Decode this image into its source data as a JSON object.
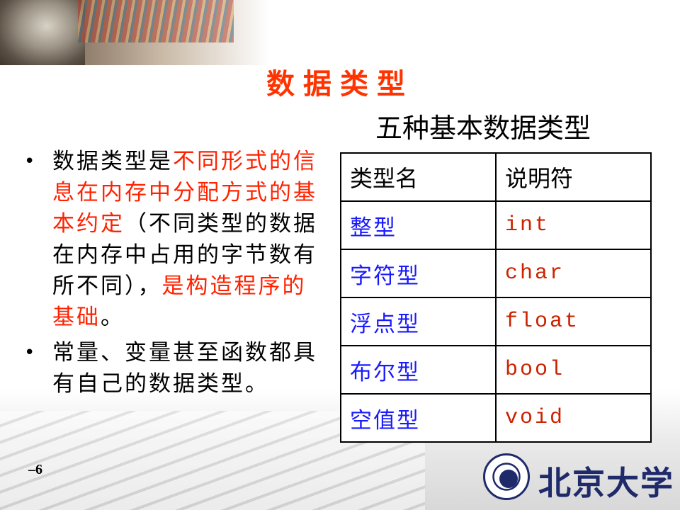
{
  "title": "数据类型",
  "subtitle": "五种基本数据类型",
  "bullets": [
    {
      "segments": [
        {
          "text": "数据类型是",
          "color": "black"
        },
        {
          "text": "不同形式的信息在内存中分配方式的基本约定",
          "color": "red"
        },
        {
          "text": "（不同类型的数据在内存中占用的字节数有所不同），",
          "color": "black"
        },
        {
          "text": "是构造程序的基础",
          "color": "red"
        },
        {
          "text": "。",
          "color": "black"
        }
      ]
    },
    {
      "segments": [
        {
          "text": "常量、变量甚至函数都具有自己的数据类型。",
          "color": "black"
        }
      ]
    }
  ],
  "table": {
    "headers": [
      "类型名",
      "说明符"
    ],
    "rows": [
      [
        "整型",
        "int"
      ],
      [
        "字符型",
        "char"
      ],
      [
        "浮点型",
        "float"
      ],
      [
        "布尔型",
        "bool"
      ],
      [
        "空值型",
        "void"
      ]
    ]
  },
  "page_number": "–6",
  "logo": {
    "name": "北京大学",
    "icon": "peking-university-seal-icon"
  },
  "colors": {
    "title": "#ff3300",
    "emphasis": "#ff2200",
    "type_name": "#1a1aff",
    "keyword": "#cc2200",
    "logo": "#1f2a6b"
  }
}
